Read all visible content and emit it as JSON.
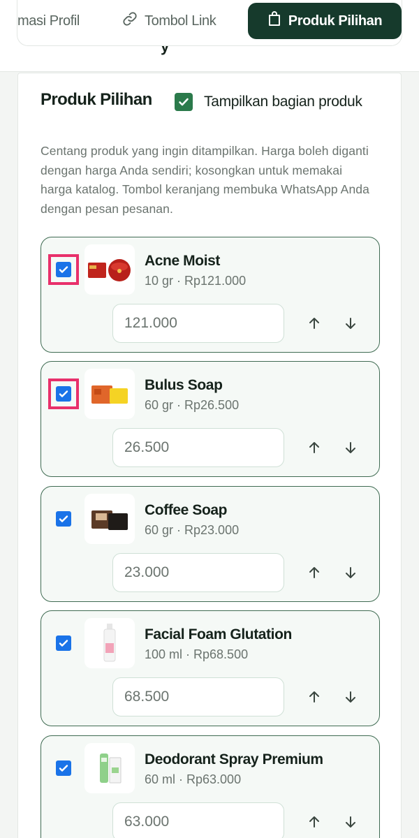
{
  "tabs": [
    {
      "label": "masi Profil",
      "icon": "person-icon",
      "active": false
    },
    {
      "label": "Tombol Link",
      "icon": "link-icon",
      "active": false
    },
    {
      "label": "Produk Pilihan",
      "icon": "bag-icon",
      "active": true
    }
  ],
  "section": {
    "title": "Produk Pilihan",
    "toggle_label": "Tampilkan bagian produk",
    "toggle_checked": true,
    "description": "Centang produk yang ingin ditampilkan. Harga boleh diganti dengan harga Anda sendiri; kosongkan untuk memakai harga katalog. Tombol keranjang membuka WhatsApp Anda dengan pesan pesanan."
  },
  "products": [
    {
      "name": "Acne Moist",
      "meta": "10 gr · Rp121.000",
      "price": "121.000",
      "checked": true,
      "highlighted": true,
      "thumb": "acne-moist-jar"
    },
    {
      "name": "Bulus Soap",
      "meta": "60 gr · Rp26.500",
      "price": "26.500",
      "checked": true,
      "highlighted": true,
      "thumb": "bulus-soap-bar"
    },
    {
      "name": "Coffee Soap",
      "meta": "60 gr · Rp23.000",
      "price": "23.000",
      "checked": true,
      "highlighted": false,
      "thumb": "coffee-soap-bar"
    },
    {
      "name": "Facial Foam Glutation",
      "meta": "100 ml · Rp68.500",
      "price": "68.500",
      "checked": true,
      "highlighted": false,
      "thumb": "facial-foam-bottle"
    },
    {
      "name": "Deodorant Spray Premium",
      "meta": "60 ml · Rp63.000",
      "price": "63.000",
      "checked": true,
      "highlighted": false,
      "thumb": "deodorant-spray-bottle"
    }
  ],
  "colors": {
    "accent_dark": "#163a2c",
    "check_green": "#2b7a4b",
    "checkbox_blue": "#1a73e8",
    "highlight_pink": "#e8306b",
    "item_border": "#3f6b52"
  }
}
